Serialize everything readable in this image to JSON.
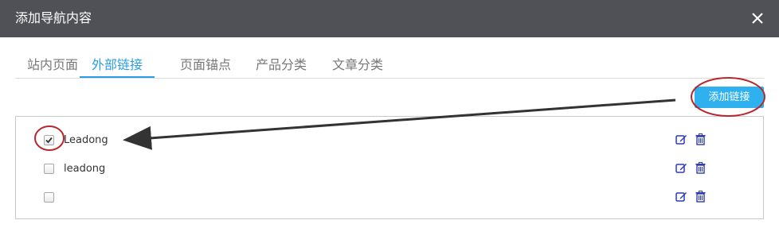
{
  "dialog": {
    "title": "添加导航内容",
    "close_icon": "close-icon"
  },
  "tabs": [
    {
      "label": "站内页面",
      "active": false
    },
    {
      "label": "外部链接",
      "active": true
    },
    {
      "label": "页面锚点",
      "active": false
    },
    {
      "label": "产品分类",
      "active": false
    },
    {
      "label": "文章分类",
      "active": false
    }
  ],
  "toolbar": {
    "add_link_label": "添加链接"
  },
  "links": [
    {
      "name": "Leadong",
      "checked": true
    },
    {
      "name": "leadong",
      "checked": false
    },
    {
      "name": "",
      "checked": false
    }
  ],
  "colors": {
    "titlebar": "#4f5156",
    "accent": "#2a9ee2",
    "button": "#2fb1ef",
    "action_icon": "#2d3bb4",
    "annotation": "#b8262a"
  }
}
